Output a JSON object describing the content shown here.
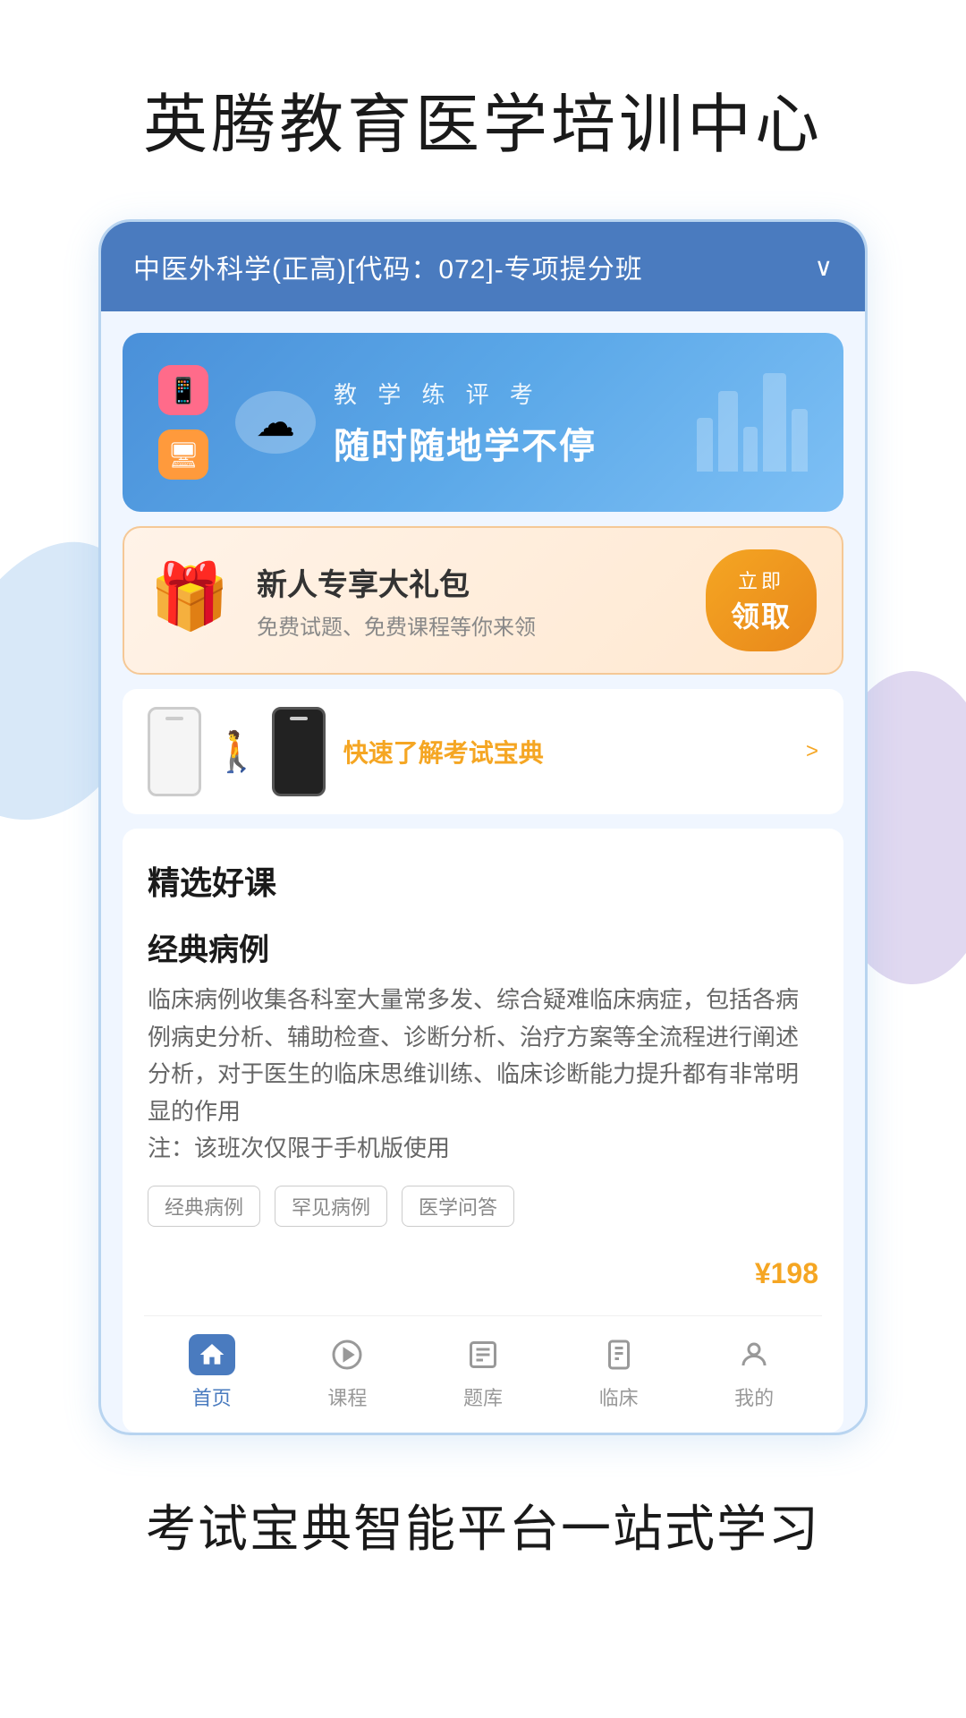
{
  "header": {
    "title": "英腾教育医学培训中心"
  },
  "course_selector": {
    "text": "中医外科学(正高)[代码：072]-专项提分班",
    "chevron": "∨"
  },
  "banner": {
    "subtitle": "教 学 练 评 考",
    "title": "随时随地学不停",
    "icons": [
      "📱",
      "🖥"
    ]
  },
  "gift_box": {
    "title": "新人专享大礼包",
    "subtitle": "免费试题、免费课程等你来领",
    "button_line1": "立即",
    "button_line2": "领取"
  },
  "quick_link": {
    "text": "快速了解考试宝典",
    "arrow": ">"
  },
  "selected_courses": {
    "section_title": "精选好课",
    "course_title": "经典病例",
    "course_desc": "临床病例收集各科室大量常多发、综合疑难临床病症，包括各病例病史分析、辅助检查、诊断分析、治疗方案等全流程进行阐述分析，对于医生的临床思维训练、临床诊断能力提升都有非常明显的作用\n注：该班次仅限于手机版使用",
    "tags": [
      "经典病例",
      "罕见病例",
      "医学问答"
    ],
    "price": "198",
    "price_symbol": "¥"
  },
  "bottom_nav": {
    "items": [
      {
        "label": "首页",
        "icon": "🏠",
        "active": true
      },
      {
        "label": "课程",
        "icon": "▷",
        "active": false
      },
      {
        "label": "题库",
        "icon": "≡",
        "active": false
      },
      {
        "label": "临床",
        "icon": "📋",
        "active": false
      },
      {
        "label": "我的",
        "icon": "○",
        "active": false
      }
    ]
  },
  "footer": {
    "title": "考试宝典智能平台一站式学习"
  }
}
